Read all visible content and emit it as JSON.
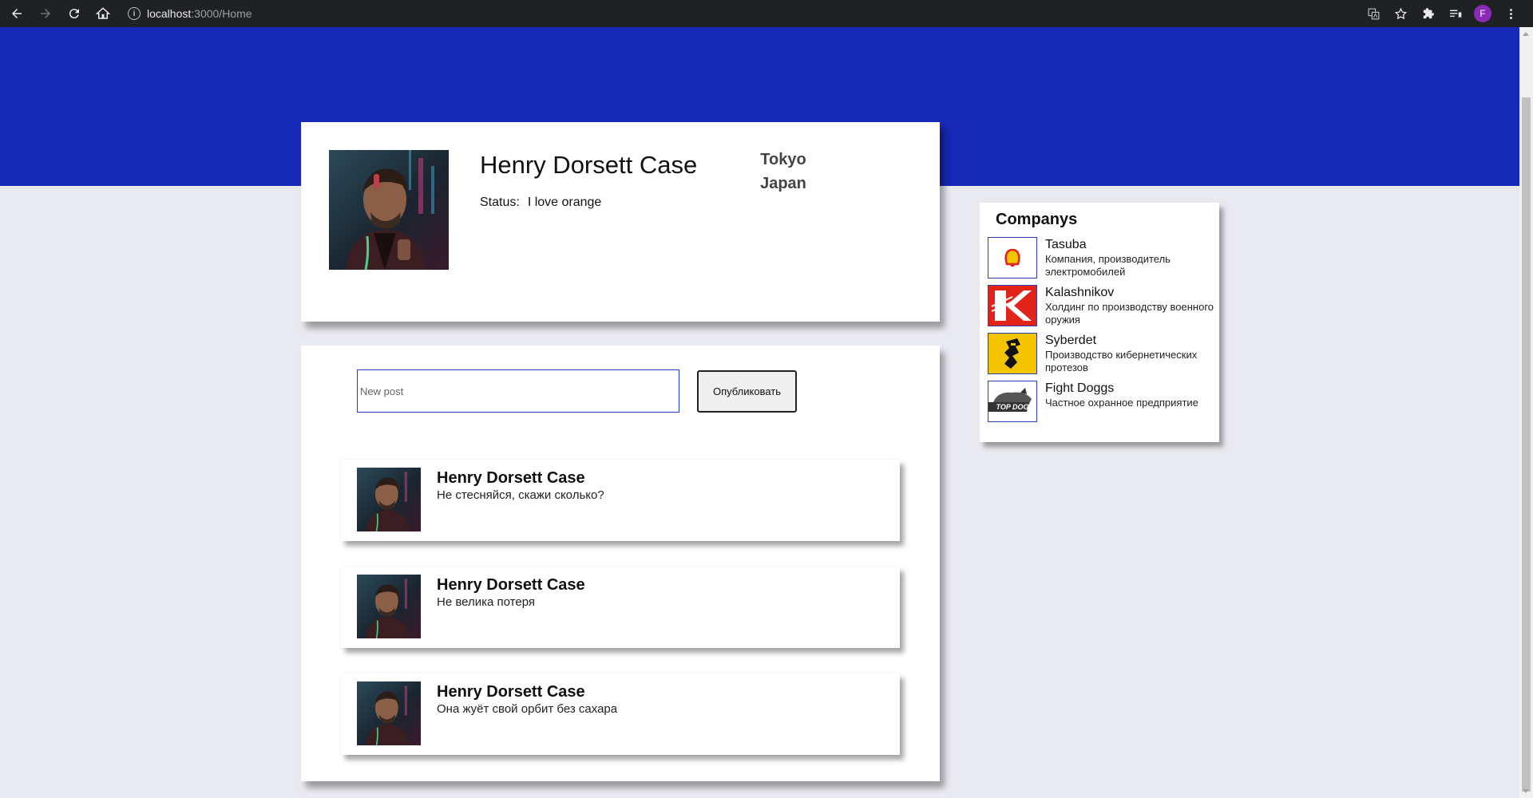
{
  "browser": {
    "url_host": "localhost",
    "url_path": ":3000/Home",
    "profile_initial": "F"
  },
  "profile": {
    "name": "Henry Dorsett Case",
    "status_label": "Status:",
    "status_value": "I love orange",
    "city": "Tokyo",
    "country": "Japan"
  },
  "new_post": {
    "placeholder": "New post",
    "value": "",
    "publish_label": "Опубликовать"
  },
  "posts": [
    {
      "author": "Henry Dorsett Case",
      "text": "Не стесняйся, скажи сколько?"
    },
    {
      "author": "Henry Dorsett Case",
      "text": "Не велика потеря"
    },
    {
      "author": "Henry Dorsett Case",
      "text": "Она жуёт свой орбит без сахара"
    }
  ],
  "companies": {
    "title": "Companys",
    "items": [
      {
        "name": "Tasuba",
        "description": "Компания, производитель электромобилей",
        "logo": "shell-logo-icon"
      },
      {
        "name": "Kalashnikov",
        "description": "Холдинг по производству военного оружия",
        "logo": "kalashnikov-k-logo-icon"
      },
      {
        "name": "Syberdet",
        "description": "Производство кибернетических протезов",
        "logo": "syberdet-logo-icon"
      },
      {
        "name": "Fight Doggs",
        "description": "Частное охранное предприятие",
        "logo": "top-dog-logo-icon"
      }
    ]
  },
  "colors": {
    "banner": "#1628b6",
    "page_background": "#e9eaf0",
    "input_border": "#1f3fb3",
    "chrome": "#202124"
  }
}
